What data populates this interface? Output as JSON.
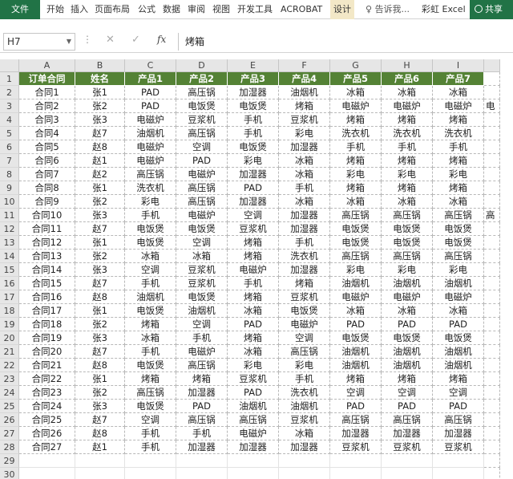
{
  "ribbon": {
    "file_tab": "文件",
    "tabs": [
      "开始",
      "插入",
      "页面布局",
      "公式",
      "数据",
      "审阅",
      "视图",
      "开发工具",
      "ACROBAT",
      "设计"
    ],
    "tell_me": "告诉我...",
    "user": "彩虹 Excel",
    "share": "共享",
    "accent_color": "#217346"
  },
  "formula_bar": {
    "name_box": "H7",
    "cancel_icon": "✕",
    "enter_icon": "✓",
    "fx_label": "fx",
    "value": "烤箱"
  },
  "sheet": {
    "columns": [
      "A",
      "B",
      "C",
      "D",
      "E",
      "F",
      "G",
      "H",
      "I"
    ],
    "row_numbers": [
      "1",
      "2",
      "3",
      "4",
      "5",
      "6",
      "7",
      "8",
      "9",
      "10",
      "11",
      "12",
      "13",
      "14",
      "15",
      "16",
      "17",
      "18",
      "19",
      "20",
      "21",
      "22",
      "23",
      "24",
      "25",
      "26",
      "27",
      "28",
      "29",
      "30"
    ],
    "header_fill": "#548235",
    "header_row": [
      "订单合同",
      "姓名",
      "产品1",
      "产品2",
      "产品3",
      "产品4",
      "产品5",
      "产品6",
      "产品7"
    ],
    "rows": [
      [
        "合同1",
        "张1",
        "PAD",
        "高压锅",
        "加湿器",
        "油烟机",
        "冰箱",
        "冰箱",
        "冰箱"
      ],
      [
        "合同2",
        "张2",
        "PAD",
        "电饭煲",
        "电饭煲",
        "烤箱",
        "电磁炉",
        "电磁炉",
        "电磁炉"
      ],
      [
        "合同3",
        "张3",
        "电磁炉",
        "豆浆机",
        "手机",
        "豆浆机",
        "烤箱",
        "烤箱",
        "烤箱"
      ],
      [
        "合同4",
        "赵7",
        "油烟机",
        "高压锅",
        "手机",
        "彩电",
        "洗衣机",
        "洗衣机",
        "洗衣机"
      ],
      [
        "合同5",
        "赵8",
        "电磁炉",
        "空调",
        "电饭煲",
        "加湿器",
        "手机",
        "手机",
        "手机"
      ],
      [
        "合同6",
        "赵1",
        "电磁炉",
        "PAD",
        "彩电",
        "冰箱",
        "烤箱",
        "烤箱",
        "烤箱"
      ],
      [
        "合同7",
        "赵2",
        "高压锅",
        "电磁炉",
        "加湿器",
        "冰箱",
        "彩电",
        "彩电",
        "彩电"
      ],
      [
        "合同8",
        "张1",
        "洗衣机",
        "高压锅",
        "PAD",
        "手机",
        "烤箱",
        "烤箱",
        "烤箱"
      ],
      [
        "合同9",
        "张2",
        "彩电",
        "高压锅",
        "加湿器",
        "冰箱",
        "冰箱",
        "冰箱",
        "冰箱"
      ],
      [
        "合同10",
        "张3",
        "手机",
        "电磁炉",
        "空调",
        "加湿器",
        "高压锅",
        "高压锅",
        "高压锅"
      ],
      [
        "合同11",
        "赵7",
        "电饭煲",
        "电饭煲",
        "豆浆机",
        "加湿器",
        "电饭煲",
        "电饭煲",
        "电饭煲"
      ],
      [
        "合同12",
        "张1",
        "电饭煲",
        "空调",
        "烤箱",
        "手机",
        "电饭煲",
        "电饭煲",
        "电饭煲"
      ],
      [
        "合同13",
        "张2",
        "冰箱",
        "冰箱",
        "烤箱",
        "洗衣机",
        "高压锅",
        "高压锅",
        "高压锅"
      ],
      [
        "合同14",
        "张3",
        "空调",
        "豆浆机",
        "电磁炉",
        "加湿器",
        "彩电",
        "彩电",
        "彩电"
      ],
      [
        "合同15",
        "赵7",
        "手机",
        "豆浆机",
        "手机",
        "烤箱",
        "油烟机",
        "油烟机",
        "油烟机"
      ],
      [
        "合同16",
        "赵8",
        "油烟机",
        "电饭煲",
        "烤箱",
        "豆浆机",
        "电磁炉",
        "电磁炉",
        "电磁炉"
      ],
      [
        "合同17",
        "张1",
        "电饭煲",
        "油烟机",
        "冰箱",
        "电饭煲",
        "冰箱",
        "冰箱",
        "冰箱"
      ],
      [
        "合同18",
        "张2",
        "烤箱",
        "空调",
        "PAD",
        "电磁炉",
        "PAD",
        "PAD",
        "PAD"
      ],
      [
        "合同19",
        "张3",
        "冰箱",
        "手机",
        "烤箱",
        "空调",
        "电饭煲",
        "电饭煲",
        "电饭煲"
      ],
      [
        "合同20",
        "赵7",
        "手机",
        "电磁炉",
        "冰箱",
        "高压锅",
        "油烟机",
        "油烟机",
        "油烟机"
      ],
      [
        "合同21",
        "赵8",
        "电饭煲",
        "高压锅",
        "彩电",
        "彩电",
        "油烟机",
        "油烟机",
        "油烟机"
      ],
      [
        "合同22",
        "张1",
        "烤箱",
        "烤箱",
        "豆浆机",
        "手机",
        "烤箱",
        "烤箱",
        "烤箱"
      ],
      [
        "合同23",
        "张2",
        "高压锅",
        "加湿器",
        "PAD",
        "洗衣机",
        "空调",
        "空调",
        "空调"
      ],
      [
        "合同24",
        "张3",
        "电饭煲",
        "PAD",
        "油烟机",
        "油烟机",
        "PAD",
        "PAD",
        "PAD"
      ],
      [
        "合同25",
        "赵7",
        "空调",
        "高压锅",
        "高压锅",
        "豆浆机",
        "高压锅",
        "高压锅",
        "高压锅"
      ],
      [
        "合同26",
        "赵8",
        "手机",
        "手机",
        "电磁炉",
        "冰箱",
        "加湿器",
        "加湿器",
        "加湿器"
      ],
      [
        "合同27",
        "赵1",
        "手机",
        "加湿器",
        "加湿器",
        "加湿器",
        "豆浆机",
        "豆浆机",
        "豆浆机"
      ]
    ],
    "overflow_col": [
      "",
      "",
      "电",
      "",
      "",
      "",
      "",
      "",
      "",
      "",
      "高",
      "",
      "",
      "",
      "",
      "",
      "",
      "",
      "",
      "",
      "",
      "",
      "",
      "",
      "",
      "",
      "",
      ""
    ]
  }
}
